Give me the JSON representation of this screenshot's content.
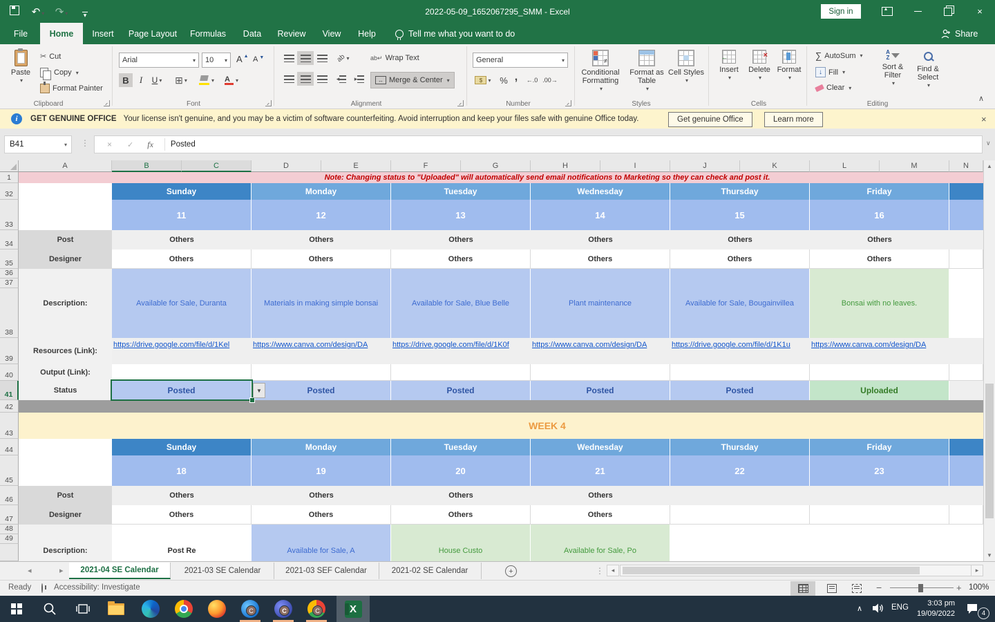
{
  "window": {
    "title": "2022-05-09_1652067295_SMM - Excel",
    "sign_in": "Sign in"
  },
  "menu": {
    "tabs": [
      "File",
      "Home",
      "Insert",
      "Page Layout",
      "Formulas",
      "Data",
      "Review",
      "View",
      "Help"
    ],
    "active_tab": "Home",
    "tell_me": "Tell me what you want to do",
    "share": "Share"
  },
  "ribbon": {
    "clipboard": {
      "group": "Clipboard",
      "paste": "Paste",
      "cut": "Cut",
      "copy": "Copy",
      "format_painter": "Format Painter"
    },
    "font": {
      "group": "Font",
      "family": "Arial",
      "size": "10",
      "bold": "B",
      "italic": "I",
      "underline": "U"
    },
    "alignment": {
      "group": "Alignment",
      "wrap_text": "Wrap Text",
      "merge_center": "Merge & Center"
    },
    "number": {
      "group": "Number",
      "format": "General",
      "percent": "%",
      "comma": ",",
      "inc_dec": "←.0",
      "dec_dec": ".00→"
    },
    "styles": {
      "group": "Styles",
      "conditional": "Conditional Formatting",
      "format_table": "Format as Table",
      "cell_styles": "Cell Styles"
    },
    "cells": {
      "group": "Cells",
      "insert": "Insert",
      "delete": "Delete",
      "format": "Format"
    },
    "editing": {
      "group": "Editing",
      "autosum": "AutoSum",
      "fill": "Fill",
      "clear": "Clear",
      "sort_filter": "Sort & Filter",
      "find_select": "Find & Select"
    }
  },
  "icons": {
    "sum": "∑",
    "scissors": "✂",
    "cancel": "×",
    "enter": "✓",
    "fx": "fx",
    "dropdown": "▾"
  },
  "notice": {
    "title": "GET GENUINE OFFICE",
    "message": "Your license isn't genuine, and you may be a victim of software counterfeiting. Avoid interruption and keep your files safe with genuine Office today.",
    "get_office": "Get genuine Office",
    "learn_more": "Learn more"
  },
  "formula_bar": {
    "name_box": "B41",
    "value": "Posted"
  },
  "grid": {
    "columns": [
      "A",
      "B",
      "C",
      "D",
      "E",
      "F",
      "G",
      "H",
      "I",
      "J",
      "K",
      "L",
      "M",
      "N"
    ],
    "row_numbers": [
      "1",
      "32",
      "33",
      "34",
      "35",
      "36",
      "37",
      "38",
      "39",
      "40",
      "41",
      "42",
      "43",
      "44",
      "45",
      "46",
      "47",
      "48",
      "49"
    ],
    "note": "Note: Changing status to \"Uploaded\" will automatically send email notifications to Marketing so they can check and post it.",
    "labels": {
      "post": "Post",
      "designer": "Designer",
      "description": "Description:",
      "resources": "Resources (Link):",
      "output": "Output (Link):",
      "status": "Status"
    },
    "week3": {
      "days": [
        "Sunday",
        "Monday",
        "Tuesday",
        "Wednesday",
        "Thursday",
        "Friday"
      ],
      "dates": [
        "11",
        "12",
        "13",
        "14",
        "15",
        "16"
      ],
      "post": [
        "Others",
        "Others",
        "Others",
        "Others",
        "Others",
        "Others"
      ],
      "designer": [
        "Others",
        "Others",
        "Others",
        "Others",
        "Others",
        "Others"
      ],
      "descriptions": [
        "Available for Sale, Duranta",
        "Materials in making simple bonsai",
        "Available for Sale, Blue Belle",
        "Plant maintenance",
        "Available for Sale, Bougainvillea",
        "Bonsai with no leaves."
      ],
      "resources": [
        "https://drive.google.com/file/d/1Kel",
        "https://www.canva.com/design/DA",
        "https://drive.google.com/file/d/1K0f",
        "https://www.canva.com/design/DA",
        "https://drive.google.com/file/d/1K1u",
        "https://www.canva.com/design/DA"
      ],
      "status": [
        "Posted",
        "Posted",
        "Posted",
        "Posted",
        "Posted",
        "Uploaded"
      ]
    },
    "week4": {
      "banner": "WEEK 4",
      "days": [
        "Sunday",
        "Monday",
        "Tuesday",
        "Wednesday",
        "Thursday",
        "Friday"
      ],
      "dates": [
        "18",
        "19",
        "20",
        "21",
        "22",
        "23"
      ],
      "post": [
        "Others",
        "Others",
        "Others",
        "Others"
      ],
      "designer": [
        "Others",
        "Others",
        "Others",
        "Others"
      ],
      "partial": {
        "b": "Post Re",
        "d": "Available for Sale, A",
        "f": "House Custo",
        "h": "Available for Sale, Po"
      }
    }
  },
  "sheet_tabs": {
    "tabs": [
      "2021-04 SE Calendar",
      "2021-03 SE Calendar",
      "2021-03 SEF Calendar",
      "2021-02 SE Calendar"
    ],
    "active": "2021-04 SE Calendar"
  },
  "status_bar": {
    "mode": "Ready",
    "accessibility": "Accessibility: Investigate",
    "zoom": "100%"
  },
  "taskbar": {
    "lang": "ENG",
    "time": "3:03 pm",
    "date": "19/09/2022",
    "badge": "4"
  }
}
